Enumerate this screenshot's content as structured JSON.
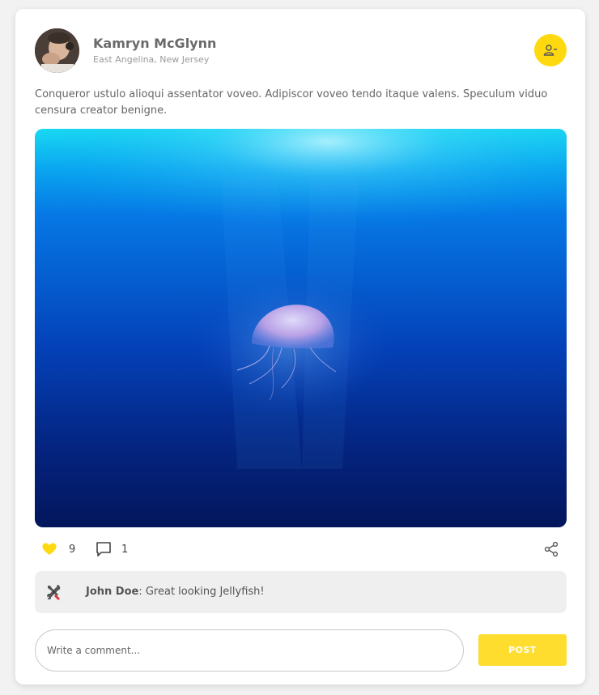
{
  "post": {
    "author": {
      "name": "Kamryn McGlynn",
      "location": "East Angelina, New Jersey",
      "avatar_icon": "user-avatar"
    },
    "follow_icon": "user-minus-icon",
    "text": "Conqueror ustulo alioqui assentator voveo. Adipiscor voveo tendo itaque valens. Speculum viduo censura creator benigne.",
    "image_subject": "jellyfish-underwater-photo"
  },
  "actions": {
    "like_icon": "heart-icon",
    "likes": "9",
    "comment_icon": "comment-icon",
    "comments": "1",
    "share_icon": "share-icon"
  },
  "comments": [
    {
      "icon": "tools-icon",
      "author": "John Doe",
      "separator": ": ",
      "text": "Great looking Jellyfish!"
    }
  ],
  "composer": {
    "placeholder": "Write a comment...",
    "post_label": "POST"
  },
  "colors": {
    "accent": "#ffd90f",
    "post_button": "#ffdd2e",
    "comment_bg": "#efefef"
  }
}
